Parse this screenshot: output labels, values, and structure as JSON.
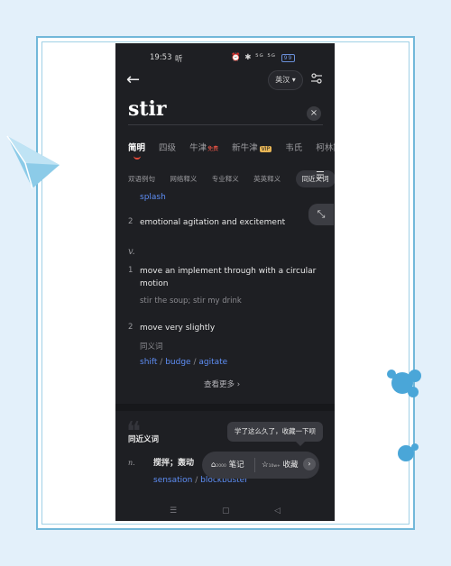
{
  "status_bar": {
    "time": "19:53",
    "network_label": "听",
    "icons_text": "⏰ ✱ ⁵ᴳ ⁵ᴳ",
    "battery": "99"
  },
  "header": {
    "back_glyph": "←",
    "language": "英汉",
    "language_caret": "▾"
  },
  "search": {
    "word": "stir",
    "clear_glyph": "×"
  },
  "tabs": {
    "items": [
      "简明",
      "四级",
      "牛津",
      "新牛津",
      "韦氏",
      "柯林斯"
    ],
    "oxford_badge": "免费",
    "new_oxford_badge": "VIP"
  },
  "subtabs": {
    "items": [
      "双语例句",
      "网络释义",
      "专业释义",
      "英英释义",
      "同近义词"
    ],
    "menu_glyph": "☰"
  },
  "expand_glyph": "⤡",
  "entries": {
    "noun_tail_link": "splash",
    "noun_sense2_num": "2",
    "noun_sense2": "emotional agitation and excitement",
    "verb_pos": "v.",
    "verb_sense1_num": "1",
    "verb_sense1_line1": "move an implement through with a circular",
    "verb_sense1_line2": "motion",
    "verb_sense1_example": "stir the soup; stir my drink",
    "verb_sense2_num": "2",
    "verb_sense2": "move very slightly",
    "synonym_label": "同义词",
    "synonyms": [
      "shift",
      "budge",
      "agitate"
    ],
    "synonym_sep": " / "
  },
  "more": "查看更多 ›",
  "synonyms_section": {
    "quote_glyph": "❝",
    "title": "同近义词",
    "pos": "n.",
    "meaning": "搅拌；轰动",
    "links": [
      "sensation",
      "blockbuster"
    ]
  },
  "tooltip": "学了这么久了，收藏一下呗",
  "action_bar": {
    "note": "笔记",
    "note_count": "2000",
    "favorite": "收藏",
    "favorite_count": "10w+",
    "arrow": "›"
  },
  "nav": {
    "menu": "☰",
    "home": "▢",
    "back": "◁"
  }
}
